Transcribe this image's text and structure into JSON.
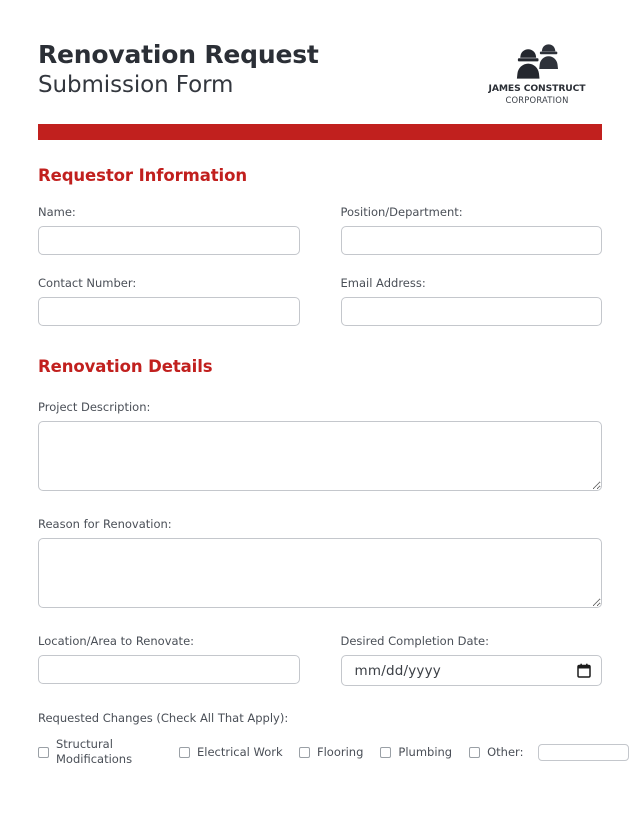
{
  "header": {
    "title_main": "Renovation Request",
    "title_sub": "Submission Form",
    "logo_icon": "construction-workers-icon",
    "logo_name": "JAMES CONSTRUCT",
    "logo_sub": "CORPORATION",
    "accent_color": "#c1201e"
  },
  "sections": {
    "requestor": {
      "heading": "Requestor Information",
      "fields": [
        {
          "label": "Name:",
          "value": "",
          "placeholder": ""
        },
        {
          "label": "Position/Department:",
          "value": "",
          "placeholder": ""
        },
        {
          "label": "Contact Number:",
          "value": "",
          "placeholder": ""
        },
        {
          "label": "Email Address:",
          "value": "",
          "placeholder": ""
        }
      ]
    },
    "details": {
      "heading": "Renovation Details",
      "project_description_label": "Project Description:",
      "project_description_value": "",
      "reason_label": "Reason for Renovation:",
      "reason_value": "",
      "location_label": "Location/Area to Renovate:",
      "location_value": "",
      "date_label": "Desired Completion Date:",
      "date_placeholder": "mm/dd/yyyy",
      "date_value": "",
      "date_icon": "calendar-icon",
      "changes_label": "Requested Changes (Check All That Apply):",
      "changes": [
        {
          "label": "Structural Modifications",
          "checked": false
        },
        {
          "label": "Electrical Work",
          "checked": false
        },
        {
          "label": "Flooring",
          "checked": false
        },
        {
          "label": "Plumbing",
          "checked": false
        },
        {
          "label": "Other:",
          "checked": false
        }
      ],
      "other_value": "",
      "other_placeholder": ""
    }
  }
}
